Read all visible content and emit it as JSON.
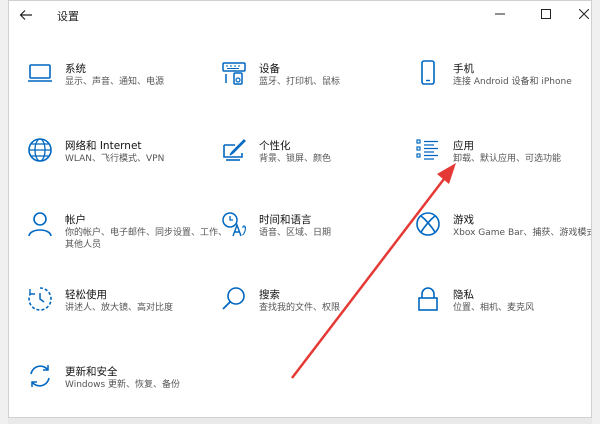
{
  "window": {
    "title": "设置"
  },
  "tiles": [
    {
      "id": "system",
      "name": "系统",
      "desc": "显示、声音、通知、电源",
      "icon": "laptop-icon"
    },
    {
      "id": "devices",
      "name": "设备",
      "desc": "蓝牙、打印机、鼠标",
      "icon": "keyboard-speaker-icon"
    },
    {
      "id": "phone",
      "name": "手机",
      "desc": "连接 Android 设备和 iPhone",
      "icon": "phone-icon"
    },
    {
      "id": "network",
      "name": "网络和 Internet",
      "desc": "WLAN、飞行模式、VPN",
      "icon": "globe-icon"
    },
    {
      "id": "personalization",
      "name": "个性化",
      "desc": "背景、锁屏、颜色",
      "icon": "pen-tablet-icon"
    },
    {
      "id": "apps",
      "name": "应用",
      "desc": "卸载、默认应用、可选功能",
      "icon": "list-icon"
    },
    {
      "id": "accounts",
      "name": "帐户",
      "desc": "你的帐户、电子邮件、同步设置、工作、其他人员",
      "icon": "person-icon"
    },
    {
      "id": "time-language",
      "name": "时间和语言",
      "desc": "语音、区域、日期",
      "icon": "language-icon"
    },
    {
      "id": "gaming",
      "name": "游戏",
      "desc": "Xbox Game Bar、捕获、游戏模式",
      "icon": "xbox-icon"
    },
    {
      "id": "ease-of-access",
      "name": "轻松使用",
      "desc": "讲述人、放大镜、高对比度",
      "icon": "ease-timer-icon"
    },
    {
      "id": "search",
      "name": "搜索",
      "desc": "查找我的文件、权限",
      "icon": "search-icon"
    },
    {
      "id": "privacy",
      "name": "隐私",
      "desc": "位置、相机、麦克风",
      "icon": "lock-icon"
    },
    {
      "id": "update-security",
      "name": "更新和安全",
      "desc": "Windows 更新、恢复、备份",
      "icon": "sync-icon"
    }
  ],
  "colors": {
    "accent": "#0067c0",
    "arrow": "#e53935"
  }
}
